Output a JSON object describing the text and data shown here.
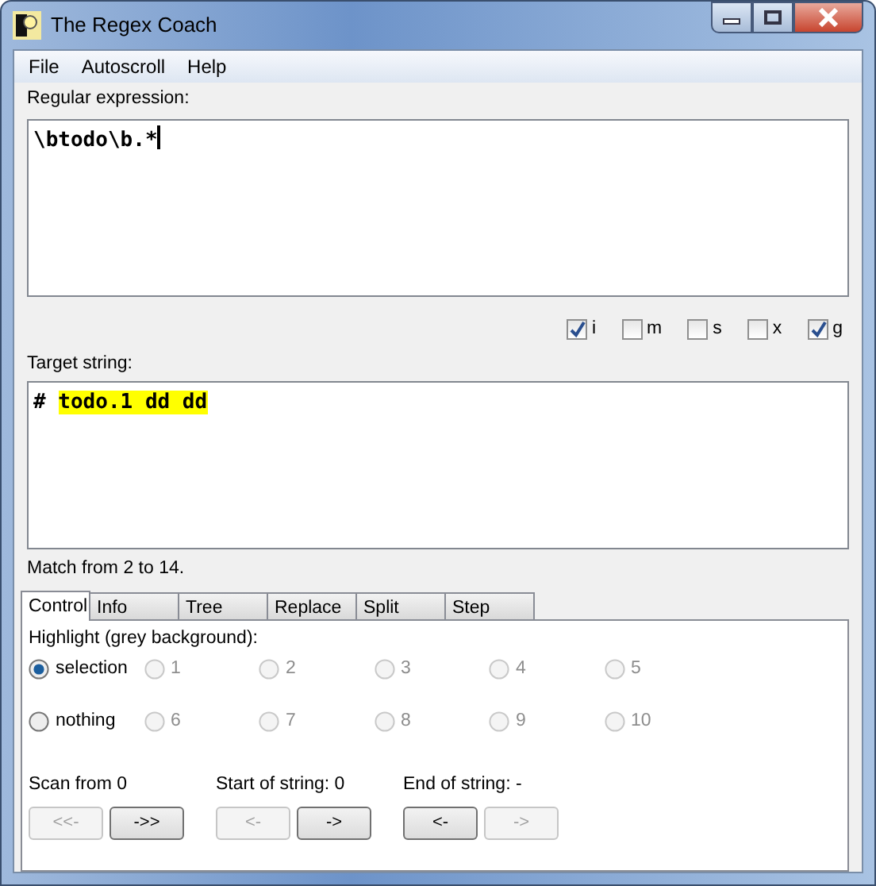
{
  "window": {
    "title": "The Regex Coach"
  },
  "menu": [
    "File",
    "Autoscroll",
    "Help"
  ],
  "regex": {
    "label": "Regular expression:",
    "value": "\\btodo\\b.*"
  },
  "flags": [
    {
      "label": "i",
      "checked": true
    },
    {
      "label": "m",
      "checked": false
    },
    {
      "label": "s",
      "checked": false
    },
    {
      "label": "x",
      "checked": false
    },
    {
      "label": "g",
      "checked": true
    }
  ],
  "target": {
    "label": "Target string:",
    "segments": [
      {
        "text": "# ",
        "highlighted": false
      },
      {
        "text": "todo.1 dd dd",
        "highlighted": true
      }
    ]
  },
  "match_info": "Match from 2 to 14.",
  "tabs": [
    {
      "label": "Control",
      "selected": true
    },
    {
      "label": "Info",
      "selected": false
    },
    {
      "label": "Tree",
      "selected": false
    },
    {
      "label": "Replace",
      "selected": false
    },
    {
      "label": "Split",
      "selected": false
    },
    {
      "label": "Step",
      "selected": false
    }
  ],
  "highlight": {
    "label": "Highlight (grey background):",
    "options": [
      {
        "label": "selection",
        "selected": true,
        "disabled": false
      },
      {
        "label": "1",
        "selected": false,
        "disabled": true
      },
      {
        "label": "2",
        "selected": false,
        "disabled": true
      },
      {
        "label": "3",
        "selected": false,
        "disabled": true
      },
      {
        "label": "4",
        "selected": false,
        "disabled": true
      },
      {
        "label": "5",
        "selected": false,
        "disabled": true
      },
      {
        "label": "nothing",
        "selected": false,
        "disabled": false
      },
      {
        "label": "6",
        "selected": false,
        "disabled": true
      },
      {
        "label": "7",
        "selected": false,
        "disabled": true
      },
      {
        "label": "8",
        "selected": false,
        "disabled": true
      },
      {
        "label": "9",
        "selected": false,
        "disabled": true
      },
      {
        "label": "10",
        "selected": false,
        "disabled": true
      }
    ]
  },
  "controls": [
    {
      "label": "Scan from 0",
      "buttons": [
        {
          "label": "<<-",
          "disabled": true
        },
        {
          "label": "->>",
          "disabled": false
        }
      ]
    },
    {
      "label": "Start of string: 0",
      "buttons": [
        {
          "label": "<-",
          "disabled": true
        },
        {
          "label": "->",
          "disabled": false
        }
      ]
    },
    {
      "label": "End of string: -",
      "buttons": [
        {
          "label": "<-",
          "disabled": false
        },
        {
          "label": "->",
          "disabled": true
        }
      ]
    }
  ]
}
